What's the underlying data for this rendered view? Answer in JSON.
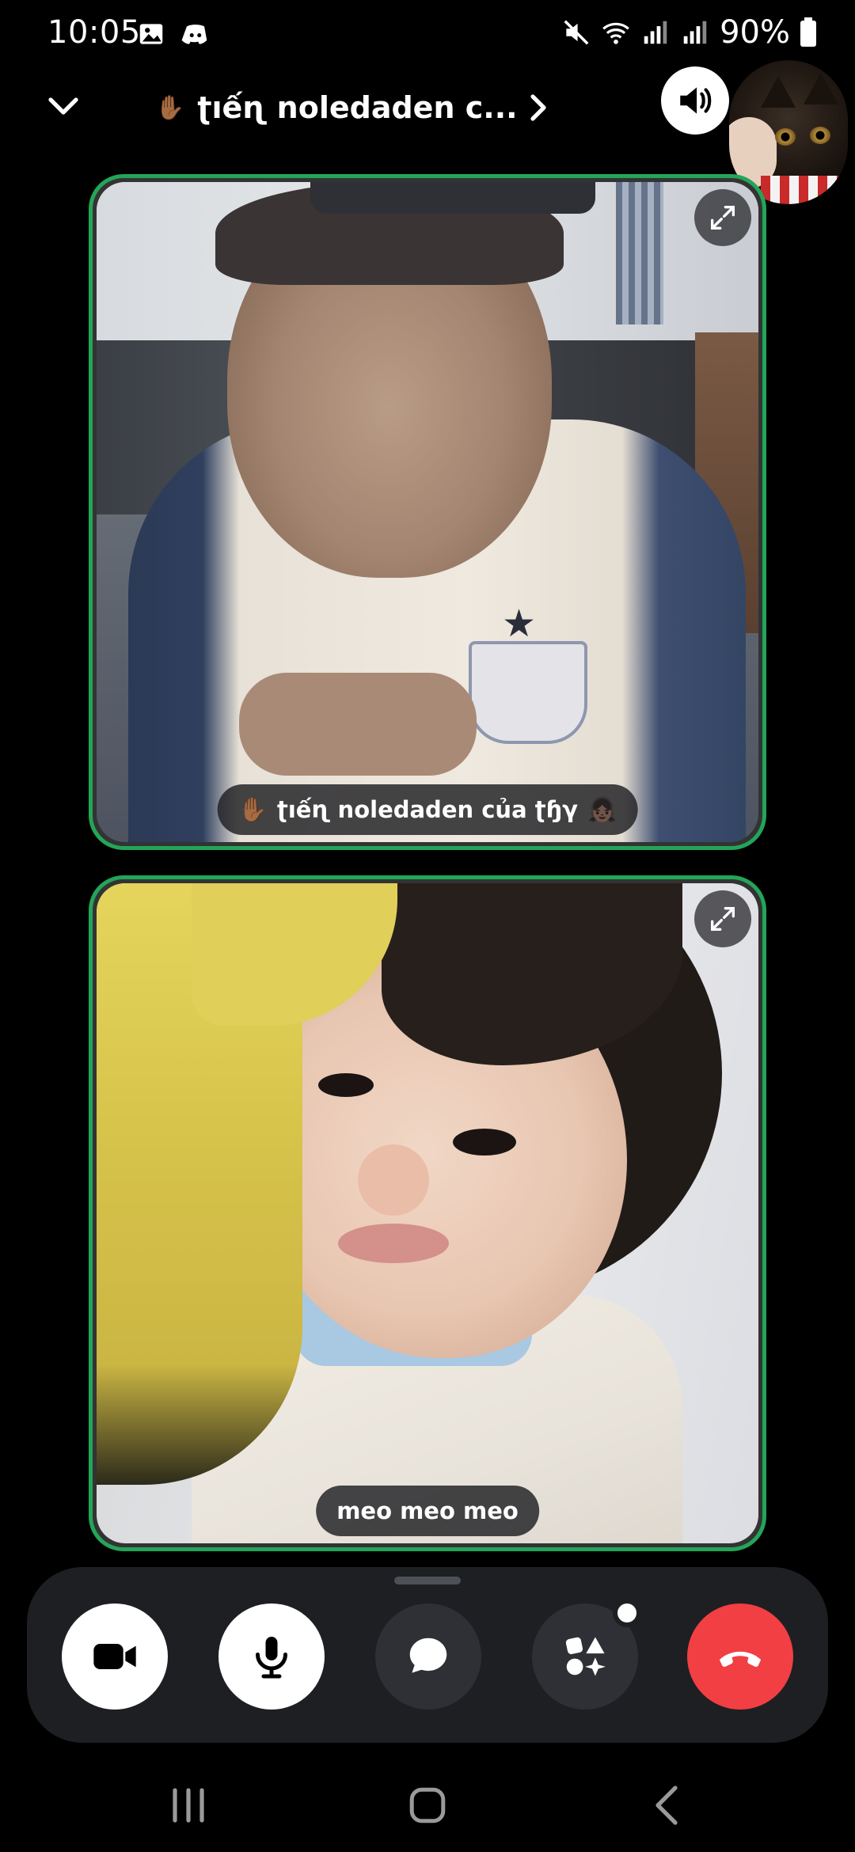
{
  "status_bar": {
    "time": "10:05",
    "left_icons": [
      "gallery-icon",
      "discord-icon"
    ],
    "right_icons": [
      "mute-icon",
      "wifi-icon",
      "signal-icon",
      "signal-icon"
    ],
    "battery": "90%"
  },
  "header": {
    "channel_emoji": "✋🏾",
    "channel_name": "ʈıếɳ noledaden c..."
  },
  "tiles": [
    {
      "emoji": "✋🏾",
      "name": "ʈıếɳ noledaden của ʈɧγ",
      "trailing_emoji": "👧🏿"
    },
    {
      "name": "meo meo meo"
    }
  ],
  "colors": {
    "speaking_border": "#23a559",
    "end_call": "#f23f43",
    "bar_bg": "#1e1f22"
  },
  "controls": [
    "camera-icon",
    "microphone-icon",
    "chat-icon",
    "activities-icon",
    "hang-up-icon"
  ],
  "nav": [
    "recent-apps-icon",
    "home-icon",
    "back-icon"
  ]
}
